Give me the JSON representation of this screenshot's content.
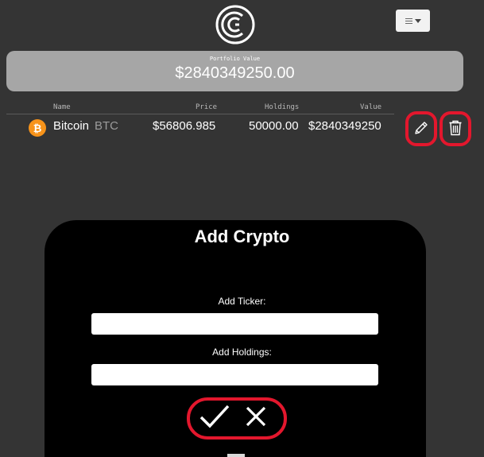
{
  "header": {
    "logo_icon": "coin-c-logo-icon",
    "menu_icon": "hamburger-dropdown-icon"
  },
  "portfolio": {
    "label": "Portfolio Value",
    "value": "$2840349250.00"
  },
  "table": {
    "columns": [
      "Name",
      "Price",
      "Holdings",
      "Value"
    ],
    "rows": [
      {
        "icon": "bitcoin-icon",
        "name": "Bitcoin",
        "ticker": "BTC",
        "price": "$56806.985",
        "holdings": "50000.00",
        "value": "$2840349250",
        "actions": [
          "edit-pencil-icon",
          "trash-icon"
        ]
      }
    ]
  },
  "modal": {
    "title": "Add Crypto",
    "ticker_label": "Add Ticker:",
    "ticker_value": "",
    "holdings_label": "Add Holdings:",
    "holdings_value": "",
    "confirm_icon": "checkmark-icon",
    "cancel_icon": "close-icon"
  },
  "colors": {
    "background": "#343434",
    "highlight": "#e3172d",
    "bitcoin": "#f7931a",
    "portfolio_bar": "#a6a6a6",
    "modal": "#000000"
  }
}
